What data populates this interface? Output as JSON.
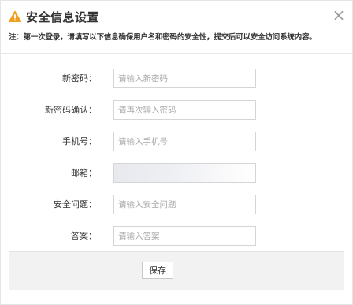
{
  "dialog": {
    "title": "安全信息设置",
    "note": "注：第一次登录，请填写以下信息确保用户名和密码的安全性，提交后可以安全访问系统内容。",
    "close_label": "×",
    "icons": {
      "warning": "warning-triangle-icon",
      "close": "close-icon"
    },
    "accent_color": "#f0a020"
  },
  "form": {
    "fields": [
      {
        "label": "新密码：",
        "placeholder": "请输入新密码",
        "value": ""
      },
      {
        "label": "新密码确认：",
        "placeholder": "请再次输入密码",
        "value": ""
      },
      {
        "label": "手机号：",
        "placeholder": "请输入手机号",
        "value": ""
      },
      {
        "label": "邮箱：",
        "placeholder": "",
        "value": ""
      },
      {
        "label": "安全问题：",
        "placeholder": "请输入安全问题",
        "value": ""
      },
      {
        "label": "答案：",
        "placeholder": "请输入答案",
        "value": ""
      }
    ]
  },
  "footer": {
    "save_label": "保存"
  }
}
